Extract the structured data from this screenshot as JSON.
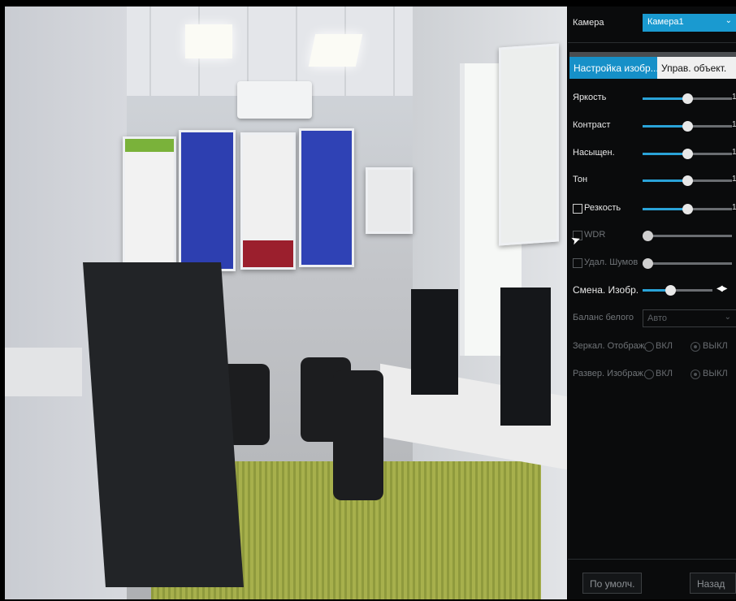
{
  "panel": {
    "camera_label": "Камера",
    "camera_value": "Камера1",
    "tabs": [
      "Настройка изобр...",
      "Управ. объект."
    ],
    "sliders": [
      {
        "label": "Яркость",
        "value": 0.5,
        "shown_value": "1",
        "enabled": true
      },
      {
        "label": "Контраст",
        "value": 0.5,
        "shown_value": "1",
        "enabled": true
      },
      {
        "label": "Насыщен.",
        "value": 0.5,
        "shown_value": "1",
        "enabled": true
      },
      {
        "label": "Тон",
        "value": 0.5,
        "shown_value": "1",
        "enabled": true
      },
      {
        "label": "Резкость",
        "value": 0.5,
        "shown_value": "1",
        "enabled": true
      },
      {
        "label": "WDR",
        "value": 0.05,
        "shown_value": "",
        "enabled": false
      },
      {
        "label": "Удал. Шумов",
        "value": 0.05,
        "shown_value": "",
        "enabled": false
      },
      {
        "label": "Смена. Изобр.",
        "value": 0.4,
        "shown_value": "",
        "enabled": true
      }
    ],
    "white_balance_label": "Баланс белого",
    "white_balance_value": "Авто",
    "mirror_label": "Зеркал. Отображ.",
    "flip_label": "Развер. Изображ.",
    "on_label": "ВКЛ",
    "off_label": "ВЫКЛ",
    "default_button": "По умолч.",
    "back_button": "Назад"
  },
  "colors": {
    "accent": "#1690c8",
    "panel_bg": "#0a0b0c"
  }
}
